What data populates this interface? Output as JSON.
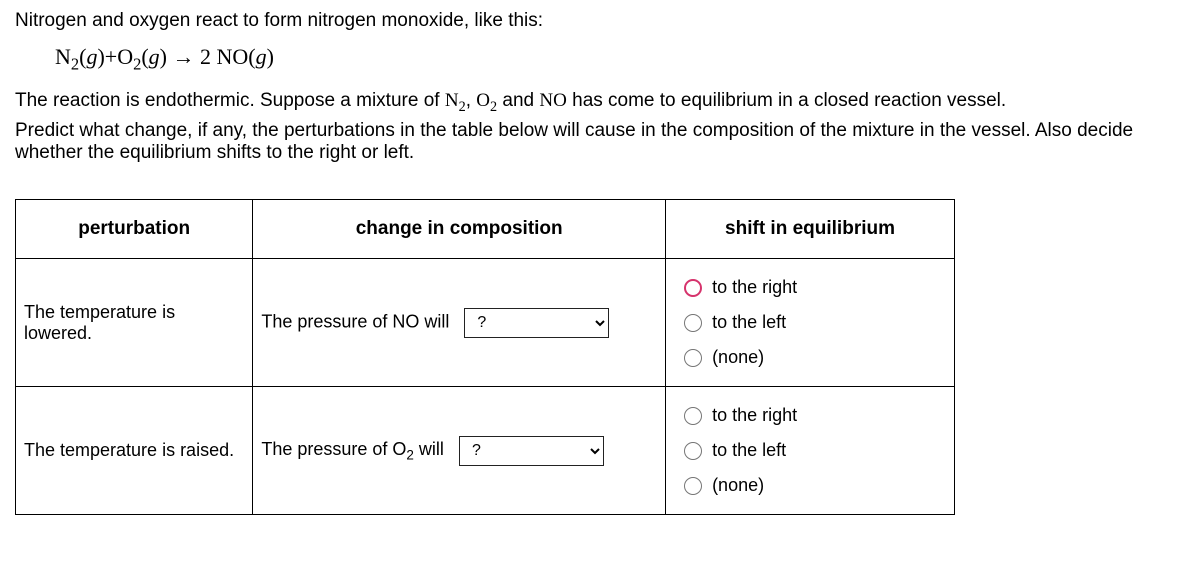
{
  "intro_line": "Nitrogen and oxygen react to form nitrogen monoxide, like this:",
  "equation_html": "N<sub>2</sub>(<span class='ital'>g</span>)+O<sub>2</sub>(<span class='ital'>g</span>) → 2 NO(<span class='ital'>g</span>)",
  "para1_before": "The reaction is endothermic. Suppose a mixture of ",
  "para1_n2": "N<sub>2</sub>",
  "para1_mid1": ", ",
  "para1_o2": "O<sub>2</sub>",
  "para1_mid2": " and ",
  "para1_no": "NO",
  "para1_after": " has come to equilibrium in a closed reaction vessel.",
  "para2": "Predict what change, if any, the perturbations in the table below will cause in the composition of the mixture in the vessel. Also decide whether the equilibrium shifts to the right or left.",
  "table": {
    "headers": [
      "perturbation",
      "change in composition",
      "shift in equilibrium"
    ],
    "rows": [
      {
        "perturbation": "The temperature is lowered.",
        "change_prefix": "The pressure of NO will",
        "change_prefix_html": "The pressure of NO will",
        "select_value": "?",
        "shift_options": [
          "to the right",
          "to the left",
          "(none)"
        ],
        "shift_selected_index": 0,
        "shift_highlight": true
      },
      {
        "perturbation": "The temperature is raised.",
        "change_prefix": "The pressure of O2 will",
        "change_prefix_html": "The pressure of O<sub>2</sub> will",
        "select_value": "?",
        "shift_options": [
          "to the right",
          "to the left",
          "(none)"
        ],
        "shift_selected_index": -1,
        "shift_highlight": false
      }
    ]
  }
}
